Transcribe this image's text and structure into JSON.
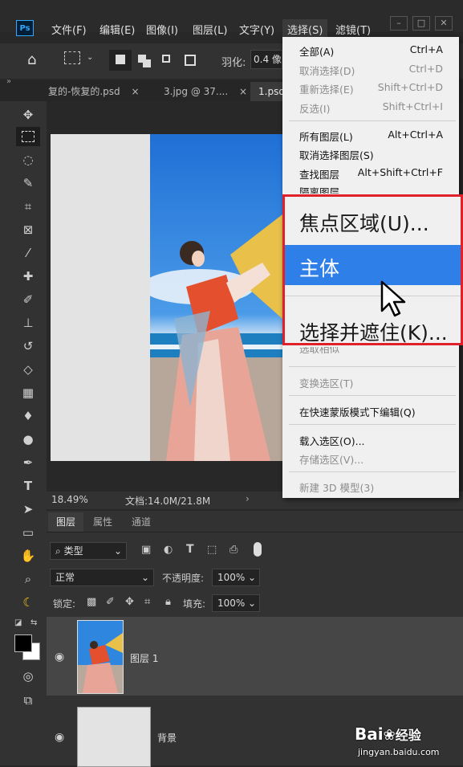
{
  "app": {
    "logo": "Ps"
  },
  "menubar": {
    "items": [
      "文件(F)",
      "编辑(E)",
      "图像(I)",
      "图层(L)",
      "文字(Y)",
      "选择(S)",
      "滤镜(T)"
    ]
  },
  "options": {
    "feather_label": "羽化:",
    "feather_value": "0.4 像"
  },
  "doc_tabs": [
    "复的-恢复的.psd",
    "3.jpg @ 37....",
    "1.psd"
  ],
  "status": {
    "zoom": "18.49%",
    "doc_size": "文档:14.0M/21.8M"
  },
  "layers_panel": {
    "tabs": [
      "图层",
      "属性",
      "通道"
    ],
    "filter_kind": "类型",
    "blend_mode": "正常",
    "opacity_label": "不透明度:",
    "opacity_value": "100%",
    "lock_label": "锁定:",
    "fill_label": "填充:",
    "fill_value": "100%",
    "layers": [
      {
        "name": "图层 1"
      },
      {
        "name": "背景"
      }
    ]
  },
  "select_menu": {
    "items": [
      {
        "label": "全部(A)",
        "shortcut": "Ctrl+A",
        "disabled": false
      },
      {
        "label": "取消选择(D)",
        "shortcut": "Ctrl+D",
        "disabled": true
      },
      {
        "label": "重新选择(E)",
        "shortcut": "Shift+Ctrl+D",
        "disabled": true
      },
      {
        "label": "反选(I)",
        "shortcut": "Shift+Ctrl+I",
        "disabled": true
      },
      {
        "label": "所有图层(L)",
        "shortcut": "Alt+Ctrl+A",
        "disabled": false
      },
      {
        "label": "取消选择图层(S)",
        "shortcut": "",
        "disabled": false
      },
      {
        "label": "查找图层",
        "shortcut": "Alt+Shift+Ctrl+F",
        "disabled": false
      },
      {
        "label": "隔离图层",
        "shortcut": "",
        "disabled": false
      },
      {
        "label": "选取相似",
        "shortcut": "",
        "disabled": true
      },
      {
        "label": "变换选区(T)",
        "shortcut": "",
        "disabled": true
      },
      {
        "label": "在快速蒙版模式下编辑(Q)",
        "shortcut": "",
        "disabled": false
      },
      {
        "label": "载入选区(O)...",
        "shortcut": "",
        "disabled": false
      },
      {
        "label": "存储选区(V)...",
        "shortcut": "",
        "disabled": true
      },
      {
        "label": "新建 3D 模型(3)",
        "shortcut": "",
        "disabled": true
      }
    ],
    "zoomed": {
      "focus_area": "焦点区域(U)...",
      "subject": "主体",
      "select_mask": "选择并遮住(K)..."
    }
  },
  "watermark": {
    "brand": "Bai",
    "brand_cn": "经验",
    "url": "jingyan.baidu.com"
  },
  "colors": {
    "accent": "#2f7fe8",
    "highlight_border": "#e0202a"
  }
}
